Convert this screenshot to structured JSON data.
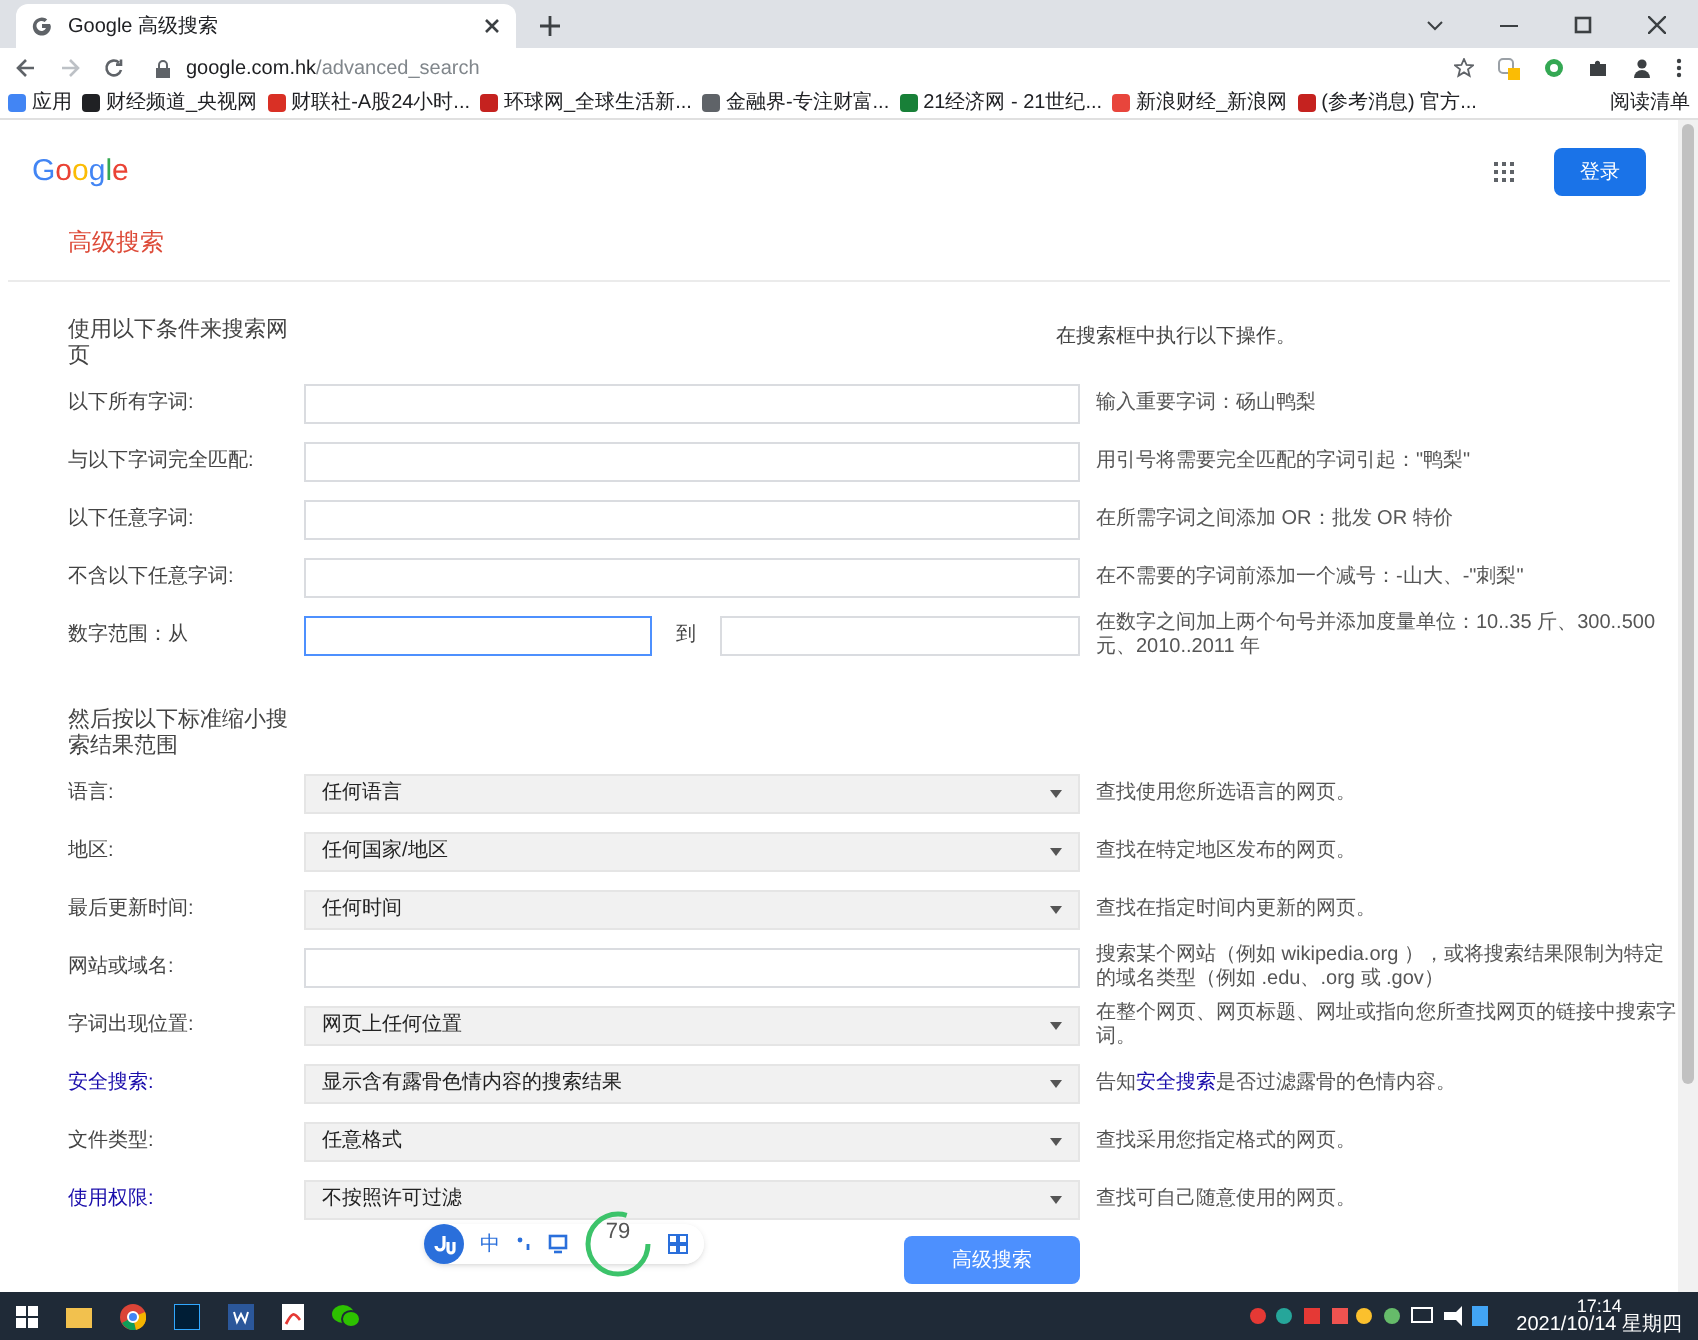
{
  "browser": {
    "tab_title": "Google 高级搜索",
    "url_host": "google.com.hk",
    "url_path": "/advanced_search",
    "bookmarks": [
      {
        "label": "应用",
        "color": "#4285f4"
      },
      {
        "label": "财经频道_央视网",
        "color": "#202124"
      },
      {
        "label": "财联社-A股24小时...",
        "color": "#d93025"
      },
      {
        "label": "环球网_全球生活新...",
        "color": "#c5221f"
      },
      {
        "label": "金融界-专注财富...",
        "color": "#5f6368"
      },
      {
        "label": "21经济网 - 21世纪...",
        "color": "#188038"
      },
      {
        "label": "新浪财经_新浪网",
        "color": "#e8453c"
      },
      {
        "label": "(参考消息) 官方...",
        "color": "#c5221f"
      }
    ],
    "reading_list": "阅读清单"
  },
  "header": {
    "logo": "Google",
    "sign_in": "登录"
  },
  "title": "高级搜索",
  "find": {
    "heading": "使用以下条件来搜索网页",
    "hint_heading": "在搜索框中执行以下操作。",
    "rows": [
      {
        "kind": "text",
        "label": "以下所有字词:",
        "hint": "输入重要字词：砀山鸭梨"
      },
      {
        "kind": "text",
        "label": "与以下字词完全匹配:",
        "hint": "用引号将需要完全匹配的字词引起：\"鸭梨\""
      },
      {
        "kind": "text",
        "label": "以下任意字词:",
        "hint": "在所需字词之间添加 OR：批发 OR 特价"
      },
      {
        "kind": "text",
        "label": "不含以下任意字词:",
        "hint": "在不需要的字词前添加一个减号：-山大、-\"刺梨\""
      },
      {
        "kind": "range",
        "label": "数字范围：从",
        "to_label": "到",
        "focused": true,
        "hint": "在数字之间加上两个句号并添加度量单位：10..35 斤、300..500 元、2010..2011 年"
      }
    ]
  },
  "narrow": {
    "heading": "然后按以下标准缩小搜索结果范围",
    "rows": [
      {
        "kind": "select",
        "label": "语言:",
        "link": false,
        "value": "任何语言",
        "hint": "查找使用您所选语言的网页。"
      },
      {
        "kind": "select",
        "label": "地区:",
        "link": false,
        "value": "任何国家/地区",
        "hint": "查找在特定地区发布的网页。"
      },
      {
        "kind": "select",
        "label": "最后更新时间:",
        "link": false,
        "value": "任何时间",
        "hint": "查找在指定时间内更新的网页。"
      },
      {
        "kind": "text",
        "label": "网站或域名:",
        "link": false,
        "hint": "搜索某个网站（例如 wikipedia.org ），或将搜索结果限制为特定的域名类型（例如 .edu、.org 或 .gov）"
      },
      {
        "kind": "select",
        "label": "字词出现位置:",
        "link": false,
        "value": "网页上任何位置",
        "hint": "在整个网页、网页标题、网址或指向您所查找网页的链接中搜索字词。"
      },
      {
        "kind": "select",
        "label": "安全搜索:",
        "link": true,
        "value": "显示含有露骨色情内容的搜索结果",
        "hint_before": "告知",
        "hint_link": "安全搜索",
        "hint": "是否过滤露骨的色情内容。"
      },
      {
        "kind": "select",
        "label": "文件类型:",
        "link": false,
        "value": "任意格式",
        "hint": "查找采用您指定格式的网页。"
      },
      {
        "kind": "select",
        "label": "使用权限:",
        "link": true,
        "value": "不按照许可过滤",
        "hint": "查找可自己随意使用的网页。"
      }
    ]
  },
  "submit": "高级搜索",
  "ime": {
    "mode": "中",
    "score": "79"
  },
  "taskbar": {
    "time": "17:14",
    "date": "2021/10/14 星期四"
  }
}
